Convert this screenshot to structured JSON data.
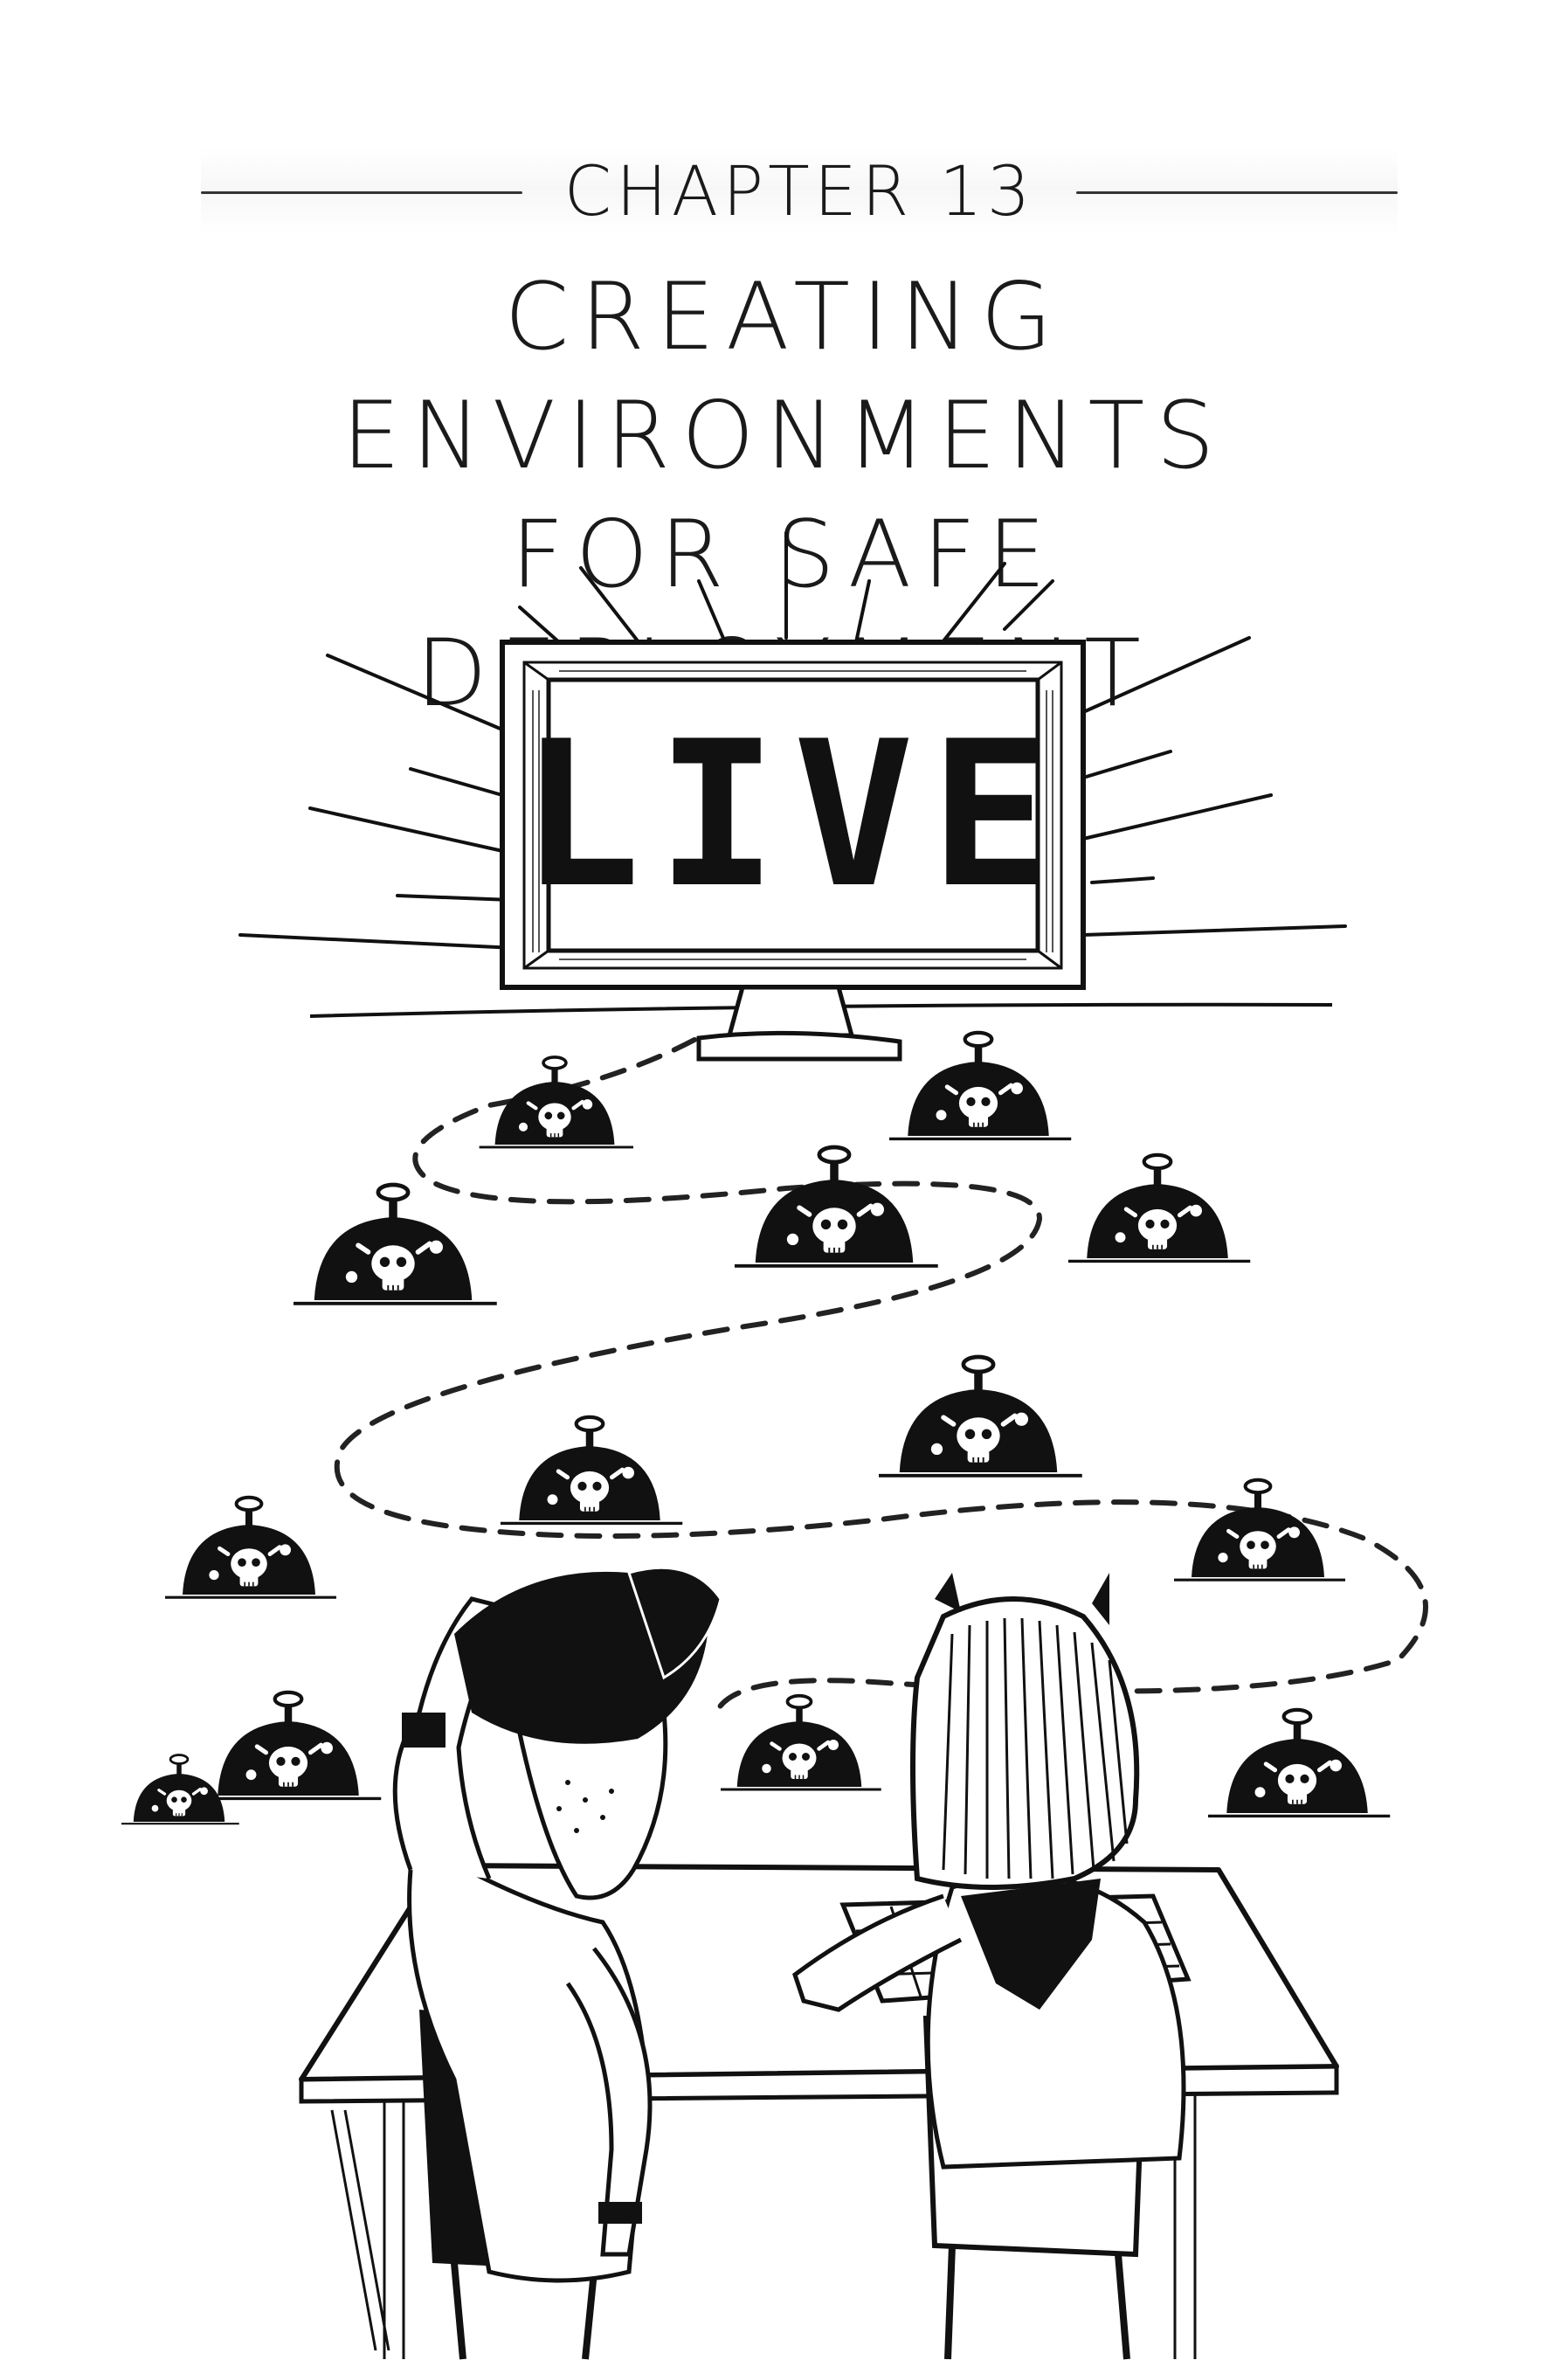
{
  "header": {
    "chapter_label": "CHAPTER 13",
    "title_lines": [
      "CREATING ENVIRONMENTS",
      "FOR SAFE DEPLOYMENT"
    ]
  },
  "illustration": {
    "monitor_screen_text": "LIVE",
    "icons": [
      "monitor-icon",
      "mine-icon",
      "skull-icon",
      "person-icon",
      "desk-icon",
      "keyboard-icon",
      "chair-icon"
    ],
    "mine_count": 13
  },
  "colors": {
    "ink": "#111111",
    "paper": "#ffffff"
  }
}
